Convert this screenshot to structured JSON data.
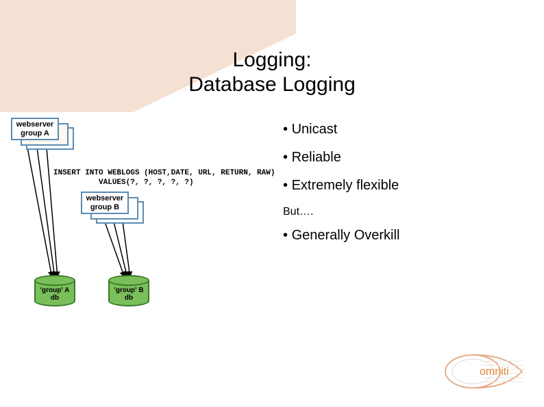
{
  "title": {
    "line1": "Logging:",
    "line2": "Database Logging"
  },
  "diagram": {
    "groupA": {
      "line1": "webserver",
      "line2": "group A"
    },
    "groupB": {
      "line1": "webserver",
      "line2": "group B"
    },
    "sql": {
      "line1": "INSERT INTO WEBLOGS (HOST,DATE, URL, RETURN, RAW)",
      "line2": "          VALUES(?, ?, ?, ?, ?)"
    },
    "dbA": "'group' A\ndb",
    "dbB": "'group' B\ndb"
  },
  "bullets": {
    "b1": "Unicast",
    "b2": "Reliable",
    "b3": "Extremely flexible",
    "but": "But….",
    "b4": "Generally Overkill"
  },
  "logo": {
    "text": "omniti"
  }
}
